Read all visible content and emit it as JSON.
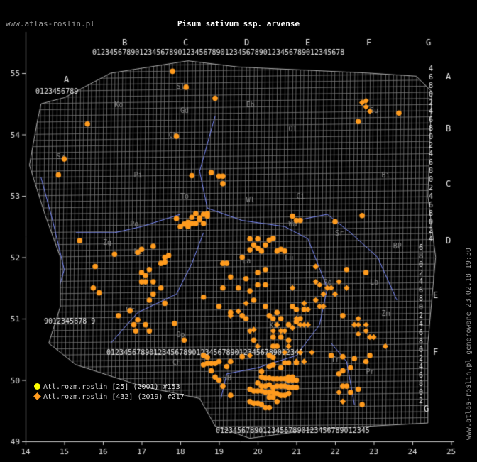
{
  "header": {
    "site_url": "www.atlas-roslin.pl",
    "title": "Pisum sativum ssp. arvense"
  },
  "side_text": "www.atlas-roslin.pl generowane 23.02.18 19:30",
  "axes": {
    "lon_labels": [
      "14",
      "15",
      "16",
      "17",
      "18",
      "19",
      "20",
      "21",
      "22",
      "23",
      "24",
      "25"
    ],
    "lat_labels": [
      "49",
      "50",
      "51",
      "52",
      "53",
      "54",
      "55"
    ]
  },
  "grid": {
    "top_row_labels": [
      "A",
      "B",
      "C",
      "D",
      "E",
      "F",
      "G"
    ],
    "digits": "0123456789",
    "right_letters": [
      "A",
      "B",
      "C",
      "D",
      "E",
      "F",
      "G"
    ]
  },
  "region_labels": [
    "Sl",
    "Ko",
    "Ch",
    "Eb",
    "Ol",
    "Sz",
    "Pi",
    "Gd",
    "Su",
    "Bi",
    "To",
    "Wl",
    "Ci",
    "Po",
    "Sr",
    "BP",
    "Zg",
    "Le",
    "Lu",
    "Wa",
    "La",
    "Wr",
    "Rd",
    "Lb",
    "Op",
    "Ki",
    "Ch",
    "Tr",
    "BB",
    "NS",
    "Zm",
    "Pr"
  ],
  "legend": [
    {
      "symbol": "circle",
      "color": "#ffff00",
      "label": "Atl.rozm.roslin [25] (2001) #153"
    },
    {
      "symbol": "diamond",
      "color": "#ff9b1e",
      "label": "Atl.rozm.roslin [432] (2019) #217"
    }
  ],
  "colors": {
    "background": "#000000",
    "grid": "#7a7a7a",
    "boundary": "#aaaaaa",
    "rivers": "#7f8fff",
    "record": "#ff9b1e"
  },
  "points": {
    "circles": [
      [
        17.8,
        55.03
      ],
      [
        18.15,
        54.77
      ],
      [
        18.9,
        54.59
      ],
      [
        15.6,
        54.17
      ],
      [
        17.9,
        53.97
      ],
      [
        23.65,
        54.35
      ],
      [
        22.6,
        54.21
      ],
      [
        15.0,
        53.6
      ],
      [
        14.85,
        53.34
      ],
      [
        18.3,
        53.33
      ],
      [
        18.8,
        53.38
      ],
      [
        19.0,
        53.32
      ],
      [
        19.1,
        53.32
      ],
      [
        19.1,
        53.2
      ],
      [
        17.9,
        52.63
      ],
      [
        18.2,
        52.57
      ],
      [
        18.3,
        52.65
      ],
      [
        18.4,
        52.71
      ],
      [
        18.6,
        52.7
      ],
      [
        18.7,
        52.67
      ],
      [
        18.5,
        52.61
      ],
      [
        18.4,
        52.55
      ],
      [
        18.6,
        52.55
      ],
      [
        18.1,
        52.54
      ],
      [
        18.2,
        52.5
      ],
      [
        18.3,
        52.55
      ],
      [
        18.0,
        52.5
      ],
      [
        18.5,
        52.64
      ],
      [
        18.7,
        52.71
      ],
      [
        20.9,
        52.67
      ],
      [
        21.0,
        52.6
      ],
      [
        21.1,
        52.6
      ],
      [
        22.0,
        52.58
      ],
      [
        22.7,
        52.68
      ],
      [
        15.4,
        52.27
      ],
      [
        16.3,
        52.05
      ],
      [
        15.8,
        51.85
      ],
      [
        16.9,
        52.08
      ],
      [
        17.0,
        52.13
      ],
      [
        17.3,
        52.18
      ],
      [
        17.5,
        51.9
      ],
      [
        17.6,
        51.92
      ],
      [
        17.6,
        52.0
      ],
      [
        17.7,
        52.03
      ],
      [
        17.2,
        51.8
      ],
      [
        17.0,
        51.75
      ],
      [
        17.0,
        51.6
      ],
      [
        17.3,
        51.6
      ],
      [
        17.1,
        51.6
      ],
      [
        17.1,
        51.7
      ],
      [
        17.5,
        51.5
      ],
      [
        17.3,
        51.4
      ],
      [
        17.2,
        51.3
      ],
      [
        17.6,
        51.25
      ],
      [
        16.7,
        51.13
      ],
      [
        16.8,
        50.9
      ],
      [
        16.9,
        50.98
      ],
      [
        16.85,
        50.8
      ],
      [
        17.1,
        50.9
      ],
      [
        17.2,
        50.8
      ],
      [
        16.4,
        51.05
      ],
      [
        17.85,
        50.92
      ],
      [
        18.1,
        50.65
      ],
      [
        15.75,
        51.5
      ],
      [
        15.9,
        51.42
      ],
      [
        18.6,
        51.35
      ],
      [
        19.1,
        51.9
      ],
      [
        19.2,
        51.9
      ],
      [
        19.6,
        52.0
      ],
      [
        19.8,
        52.12
      ],
      [
        19.9,
        52.2
      ],
      [
        20.0,
        52.15
      ],
      [
        20.1,
        52.1
      ],
      [
        20.2,
        52.2
      ],
      [
        20.3,
        52.28
      ],
      [
        20.4,
        52.31
      ],
      [
        20.5,
        52.1
      ],
      [
        20.6,
        52.13
      ],
      [
        20.7,
        52.1
      ],
      [
        19.8,
        52.3
      ],
      [
        20.0,
        52.3
      ],
      [
        20.2,
        51.8
      ],
      [
        20.0,
        51.75
      ],
      [
        19.7,
        51.65
      ],
      [
        19.3,
        51.68
      ],
      [
        19.1,
        51.5
      ],
      [
        19.5,
        51.5
      ],
      [
        19.8,
        51.45
      ],
      [
        20.0,
        51.55
      ],
      [
        20.2,
        51.55
      ],
      [
        19.9,
        51.3
      ],
      [
        20.2,
        51.2
      ],
      [
        19.3,
        51.1
      ],
      [
        19.0,
        51.2
      ],
      [
        19.6,
        51.05
      ],
      [
        19.7,
        51.0
      ],
      [
        20.3,
        51.05
      ],
      [
        20.5,
        51.1
      ],
      [
        20.4,
        51.0
      ],
      [
        20.6,
        51.0
      ],
      [
        20.8,
        50.9
      ],
      [
        21.0,
        50.95
      ],
      [
        21.1,
        51.0
      ],
      [
        20.9,
        51.2
      ],
      [
        21.0,
        51.15
      ],
      [
        21.2,
        51.15
      ],
      [
        20.4,
        50.7
      ],
      [
        20.6,
        50.7
      ],
      [
        20.8,
        50.65
      ],
      [
        20.4,
        50.55
      ],
      [
        20.5,
        50.55
      ],
      [
        19.9,
        50.65
      ],
      [
        20.3,
        50.4
      ],
      [
        20.4,
        50.37
      ],
      [
        20.7,
        50.28
      ],
      [
        20.8,
        50.28
      ],
      [
        21.0,
        50.28
      ],
      [
        20.1,
        50.14
      ],
      [
        20.3,
        50.22
      ],
      [
        20.4,
        50.25
      ],
      [
        20.6,
        50.2
      ],
      [
        20.8,
        50.05
      ],
      [
        20.9,
        50.05
      ],
      [
        20.1,
        50.05
      ],
      [
        20.2,
        50.03
      ],
      [
        20.3,
        50.03
      ],
      [
        20.4,
        50.02
      ],
      [
        20.5,
        50.02
      ],
      [
        20.6,
        50.02
      ],
      [
        20.7,
        50.02
      ],
      [
        20.8,
        50.0
      ],
      [
        20.9,
        50.0
      ],
      [
        21.0,
        50.0
      ],
      [
        20.0,
        49.95
      ],
      [
        20.1,
        49.9
      ],
      [
        20.2,
        49.9
      ],
      [
        20.3,
        49.92
      ],
      [
        20.4,
        49.88
      ],
      [
        20.5,
        49.9
      ],
      [
        20.6,
        49.9
      ],
      [
        20.7,
        49.9
      ],
      [
        20.8,
        49.88
      ],
      [
        20.9,
        49.88
      ],
      [
        21.0,
        49.88
      ],
      [
        19.8,
        49.85
      ],
      [
        19.9,
        49.82
      ],
      [
        20.0,
        49.82
      ],
      [
        20.1,
        49.82
      ],
      [
        20.2,
        49.8
      ],
      [
        20.3,
        49.8
      ],
      [
        20.4,
        49.8
      ],
      [
        20.5,
        49.78
      ],
      [
        20.6,
        49.75
      ],
      [
        20.7,
        49.75
      ],
      [
        20.8,
        49.78
      ],
      [
        20.3,
        49.72
      ],
      [
        20.4,
        49.72
      ],
      [
        20.5,
        49.65
      ],
      [
        19.8,
        49.65
      ],
      [
        19.9,
        49.62
      ],
      [
        20.0,
        49.62
      ],
      [
        20.2,
        49.55
      ],
      [
        20.3,
        49.55
      ],
      [
        20.1,
        49.6
      ],
      [
        19.3,
        49.75
      ],
      [
        19.1,
        49.9
      ],
      [
        19.0,
        50.0
      ],
      [
        18.9,
        50.05
      ],
      [
        18.8,
        50.15
      ],
      [
        18.6,
        50.25
      ],
      [
        18.7,
        50.27
      ],
      [
        18.8,
        50.27
      ],
      [
        18.9,
        50.27
      ],
      [
        19.0,
        50.3
      ],
      [
        19.2,
        50.22
      ],
      [
        19.3,
        50.3
      ],
      [
        19.6,
        50.38
      ],
      [
        18.6,
        50.4
      ],
      [
        18.7,
        50.37
      ],
      [
        22.2,
        49.9
      ],
      [
        22.3,
        49.9
      ],
      [
        22.1,
        50.1
      ],
      [
        22.2,
        50.15
      ],
      [
        22.4,
        50.2
      ],
      [
        22.5,
        50.35
      ],
      [
        22.2,
        50.38
      ],
      [
        21.9,
        50.4
      ],
      [
        22.8,
        50.3
      ],
      [
        22.9,
        50.4
      ],
      [
        22.6,
        49.85
      ],
      [
        22.4,
        49.8
      ],
      [
        22.7,
        49.6
      ],
      [
        22.3,
        51.8
      ],
      [
        22.8,
        51.75
      ],
      [
        22.2,
        51.05
      ]
    ],
    "diamonds": [
      [
        22.7,
        54.52
      ],
      [
        22.8,
        54.55
      ],
      [
        22.9,
        54.38
      ],
      [
        22.8,
        54.45
      ],
      [
        23.3,
        50.55
      ],
      [
        23.0,
        50.7
      ],
      [
        22.8,
        50.8
      ],
      [
        22.8,
        50.9
      ],
      [
        22.6,
        50.75
      ],
      [
        22.6,
        50.9
      ],
      [
        22.9,
        50.7
      ],
      [
        22.5,
        50.9
      ],
      [
        22.6,
        51.0
      ],
      [
        22.1,
        51.6
      ],
      [
        22.3,
        51.5
      ],
      [
        22.0,
        51.4
      ],
      [
        21.9,
        51.5
      ],
      [
        21.8,
        51.5
      ],
      [
        21.5,
        51.85
      ],
      [
        21.5,
        51.6
      ],
      [
        21.6,
        51.55
      ],
      [
        21.7,
        51.4
      ],
      [
        21.5,
        51.3
      ],
      [
        21.6,
        51.2
      ],
      [
        21.7,
        51.2
      ],
      [
        20.9,
        51.5
      ],
      [
        21.2,
        51.25
      ],
      [
        21.3,
        51.15
      ],
      [
        21.0,
        51.0
      ],
      [
        21.1,
        50.9
      ],
      [
        21.2,
        50.9
      ],
      [
        21.3,
        50.9
      ],
      [
        20.9,
        50.85
      ],
      [
        20.6,
        50.8
      ],
      [
        20.7,
        50.8
      ],
      [
        20.5,
        50.9
      ],
      [
        19.7,
        51.25
      ],
      [
        19.5,
        51.12
      ],
      [
        19.3,
        51.05
      ],
      [
        21.4,
        50.45
      ],
      [
        21.1,
        50.45
      ],
      [
        21.0,
        50.3
      ],
      [
        20.7,
        50.45
      ],
      [
        20.8,
        50.55
      ],
      [
        21.2,
        50.3
      ],
      [
        20.4,
        50.8
      ],
      [
        19.8,
        50.8
      ],
      [
        19.9,
        50.82
      ],
      [
        20.0,
        50.55
      ],
      [
        19.8,
        50.4
      ],
      [
        22.1,
        49.8
      ],
      [
        22.2,
        49.65
      ]
    ]
  }
}
